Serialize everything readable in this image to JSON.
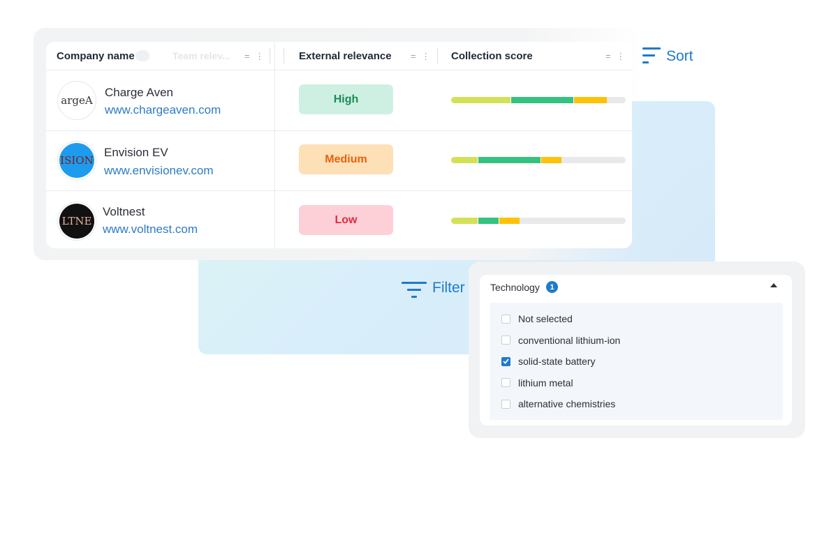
{
  "table": {
    "columns": {
      "company": "Company name",
      "team_relevance": "Team relev...",
      "external_relevance": "External relevance",
      "collection_score": "Collection score"
    },
    "rows": [
      {
        "name": "Charge Aven",
        "url": "www.chargeaven.com",
        "logo_text": "argeA",
        "logo_bg": "#ffffff",
        "logo_color": "#333333",
        "relevance": "High",
        "relevance_bg": "#cdf0e3",
        "relevance_color": "#1c8a55",
        "score": [
          {
            "share": 0.34,
            "color": "#d4e157"
          },
          {
            "share": 0.36,
            "color": "#34c27f"
          },
          {
            "share": 0.19,
            "color": "#ffc107"
          }
        ]
      },
      {
        "name": "Envision EV",
        "url": "www.envisionev.com",
        "logo_text": "VISIONE",
        "logo_bg": "#1e9bee",
        "logo_color": "#7a1a1a",
        "relevance": "Medium",
        "relevance_bg": "#fde0b6",
        "relevance_color": "#e8600f",
        "score": [
          {
            "share": 0.15,
            "color": "#d4e157"
          },
          {
            "share": 0.36,
            "color": "#34c27f"
          },
          {
            "share": 0.12,
            "color": "#ffc107"
          }
        ]
      },
      {
        "name": "Voltnest",
        "url": "www.voltnest.com",
        "logo_text": "LTNE",
        "logo_bg": "#111111",
        "logo_color": "#e6b0a0",
        "relevance": "Low",
        "relevance_bg": "#fdd0d7",
        "relevance_color": "#e02b3a",
        "score": [
          {
            "share": 0.15,
            "color": "#d4e157"
          },
          {
            "share": 0.12,
            "color": "#34c27f"
          },
          {
            "share": 0.12,
            "color": "#ffc107"
          }
        ]
      }
    ]
  },
  "actions": {
    "sort_label": "Sort",
    "filter_label": "Filter"
  },
  "filter_panel": {
    "title": "Technology",
    "selected_count": "1",
    "options": [
      {
        "label": "Not selected",
        "checked": false
      },
      {
        "label": "conventional lithium-ion",
        "checked": false
      },
      {
        "label": "solid-state battery",
        "checked": true
      },
      {
        "label": "lithium metal",
        "checked": false
      },
      {
        "label": "alternative chemistries",
        "checked": false
      }
    ]
  },
  "colors": {
    "accent": "#1f7acb"
  }
}
